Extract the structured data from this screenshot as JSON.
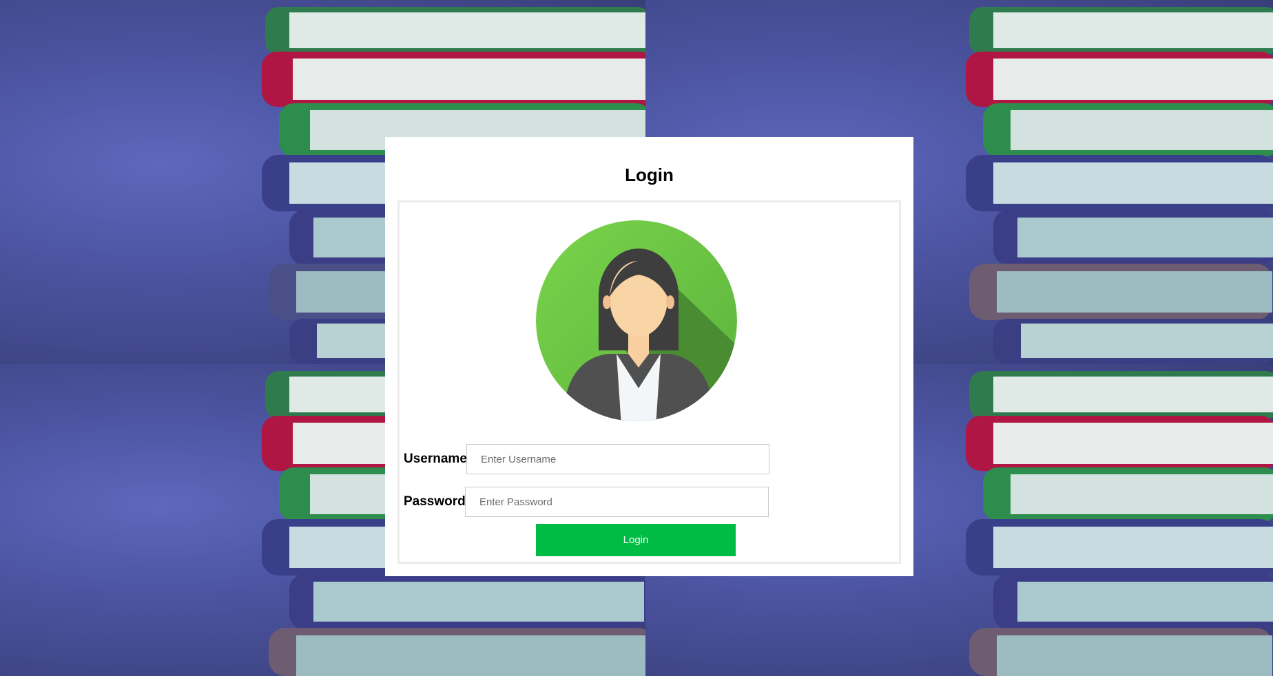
{
  "page": {
    "title": "Login"
  },
  "form": {
    "username_label": "Username",
    "username_placeholder": "Enter Username",
    "password_label": "Password",
    "password_placeholder": "Enter Password",
    "submit_label": "Login"
  },
  "colors": {
    "button": "#00bb44",
    "avatar_circle": "#6cc644",
    "background_blue": "#4b539f"
  },
  "icons": {
    "avatar": "user-avatar-icon"
  }
}
